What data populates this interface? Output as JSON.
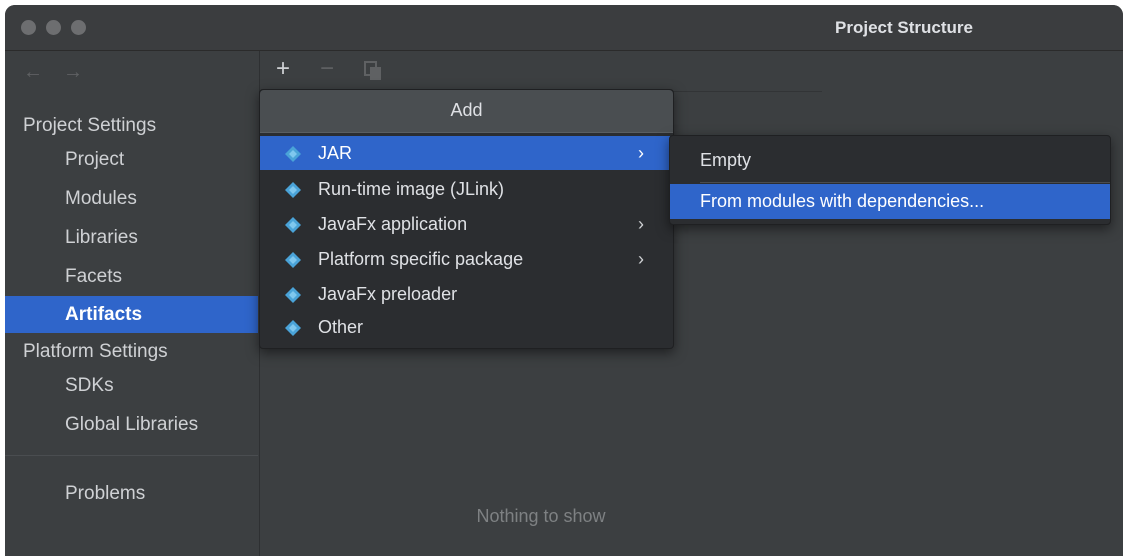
{
  "window": {
    "title": "Project Structure"
  },
  "sidebar": {
    "sections": [
      {
        "heading": "Project Settings",
        "items": [
          "Project",
          "Modules",
          "Libraries",
          "Facets",
          "Artifacts"
        ]
      },
      {
        "heading": "Platform Settings",
        "items": [
          "SDKs",
          "Global Libraries"
        ]
      }
    ],
    "selected": "Artifacts",
    "problems": "Problems"
  },
  "toolbar": {
    "add": "+",
    "remove": "−",
    "copy": "copy-icon"
  },
  "middle": {
    "empty_text": "Nothing to show"
  },
  "add_popup": {
    "title": "Add",
    "items": [
      {
        "label": "JAR",
        "submenu": true,
        "selected": true
      },
      {
        "label": "Run-time image (JLink)",
        "submenu": false
      },
      {
        "label": "JavaFx application",
        "submenu": true
      },
      {
        "label": "Platform specific package",
        "submenu": true
      },
      {
        "label": "JavaFx preloader",
        "submenu": false
      },
      {
        "label": "Other",
        "submenu": false
      }
    ]
  },
  "jar_submenu": {
    "items": [
      {
        "label": "Empty"
      },
      {
        "label": "From modules with dependencies...",
        "selected": true
      }
    ]
  },
  "colors": {
    "accent": "#2f65ca",
    "background": "#3c3f41",
    "popup": "#2b2d30"
  }
}
